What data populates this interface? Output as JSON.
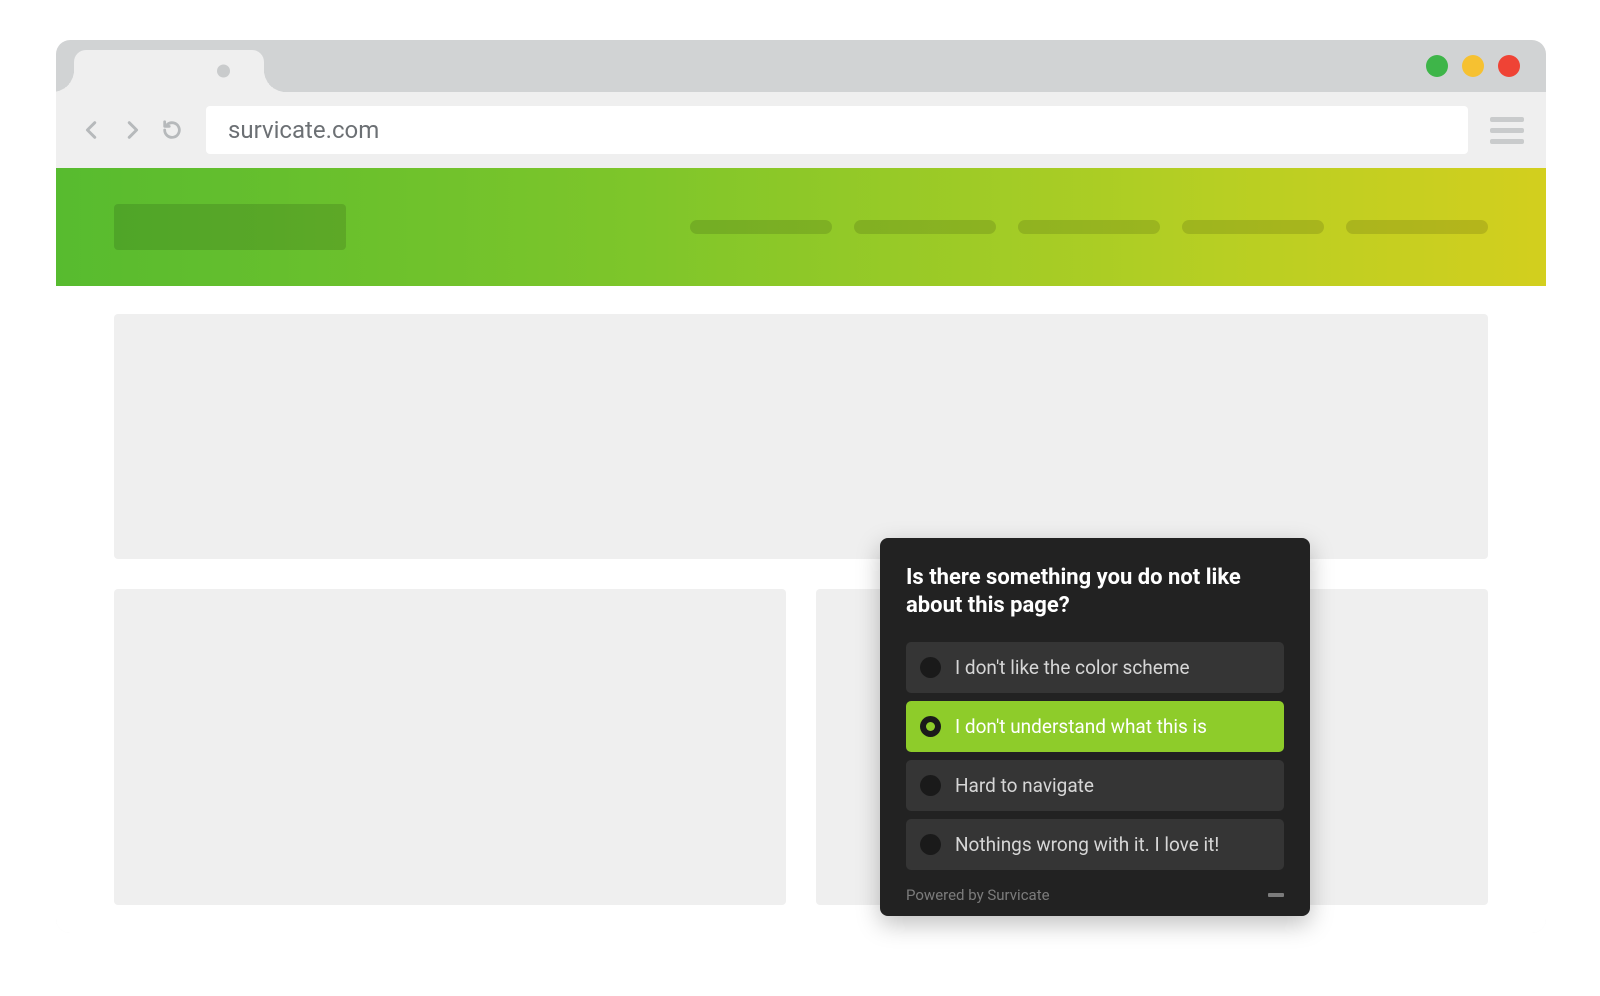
{
  "browser": {
    "url": "survicate.com"
  },
  "survey": {
    "question": "Is there something you do not like about this page?",
    "options": [
      {
        "label": "I don't like the color scheme",
        "selected": false
      },
      {
        "label": "I don't understand what this is",
        "selected": true
      },
      {
        "label": "Hard to navigate",
        "selected": false
      },
      {
        "label": "Nothings wrong with it. I love it!",
        "selected": false
      }
    ],
    "powered_by": "Powered by Survicate"
  }
}
